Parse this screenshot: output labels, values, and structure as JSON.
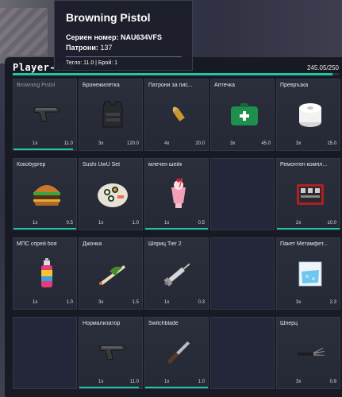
{
  "player": {
    "name": "Player-164",
    "weight": "245.05/250",
    "weight_fill_fraction": 0.98
  },
  "tooltip": {
    "title": "Browning Pistol",
    "serial_label": "Сериен номер:",
    "serial_value": "NAU634VFS",
    "ammo_label": "Патрони:",
    "ammo_value": "137",
    "details": "Тегло: 11.0 | Брой: 1"
  },
  "slots": [
    {
      "label": "Browning Pistol",
      "count": "1x",
      "weight": "11.0",
      "icon": "pistol-icon",
      "durability": 0.95
    },
    {
      "label": "Бронежилетка",
      "count": "3x",
      "weight": "120.0",
      "icon": "body-armor-icon"
    },
    {
      "label": "Патрони за пис...",
      "count": "4x",
      "weight": "20.0",
      "icon": "bullet-icon"
    },
    {
      "label": "Аптечка",
      "count": "3x",
      "weight": "45.0",
      "icon": "first-aid-kit-icon"
    },
    {
      "label": "Превръзка",
      "count": "3x",
      "weight": "15.0",
      "icon": "bandage-icon"
    },
    {
      "label": "Кокобургер",
      "count": "1x",
      "weight": "0.5",
      "icon": "burger-icon",
      "durability": 1.0
    },
    {
      "label": "Sushi UwU Set",
      "count": "1x",
      "weight": "1.0",
      "icon": "sushi-icon"
    },
    {
      "label": "млечен шейк",
      "count": "1x",
      "weight": "0.5",
      "icon": "milkshake-icon",
      "durability": 1.0
    },
    {
      "label": "",
      "count": "",
      "weight": "",
      "icon": ""
    },
    {
      "label": "Ремонтен компл...",
      "count": "2x",
      "weight": "10.0",
      "icon": "repair-kit-icon",
      "durability": 1.0
    },
    {
      "label": "МПС спрей боя",
      "count": "1x",
      "weight": "1.0",
      "icon": "spray-can-icon"
    },
    {
      "label": "Джонка",
      "count": "3x",
      "weight": "1.5",
      "icon": "joint-icon"
    },
    {
      "label": "Шприц Tier 2",
      "count": "1x",
      "weight": "0.3",
      "icon": "syringe-icon"
    },
    {
      "label": "",
      "count": "",
      "weight": "",
      "icon": ""
    },
    {
      "label": "Пакет Метамфет...",
      "count": "3x",
      "weight": "2.3",
      "icon": "meth-bag-icon"
    },
    {
      "label": "",
      "count": "",
      "weight": "",
      "icon": ""
    },
    {
      "label": "Нормализатор",
      "count": "1x",
      "weight": "11.0",
      "icon": "pistol-icon",
      "durability": 0.95
    },
    {
      "label": "Switchblade",
      "count": "1x",
      "weight": "1.0",
      "icon": "knife-icon",
      "durability": 1.0
    },
    {
      "label": "",
      "count": "",
      "weight": "",
      "icon": ""
    },
    {
      "label": "Шперц",
      "count": "3x",
      "weight": "0.9",
      "icon": "lockpick-icon"
    }
  ]
}
